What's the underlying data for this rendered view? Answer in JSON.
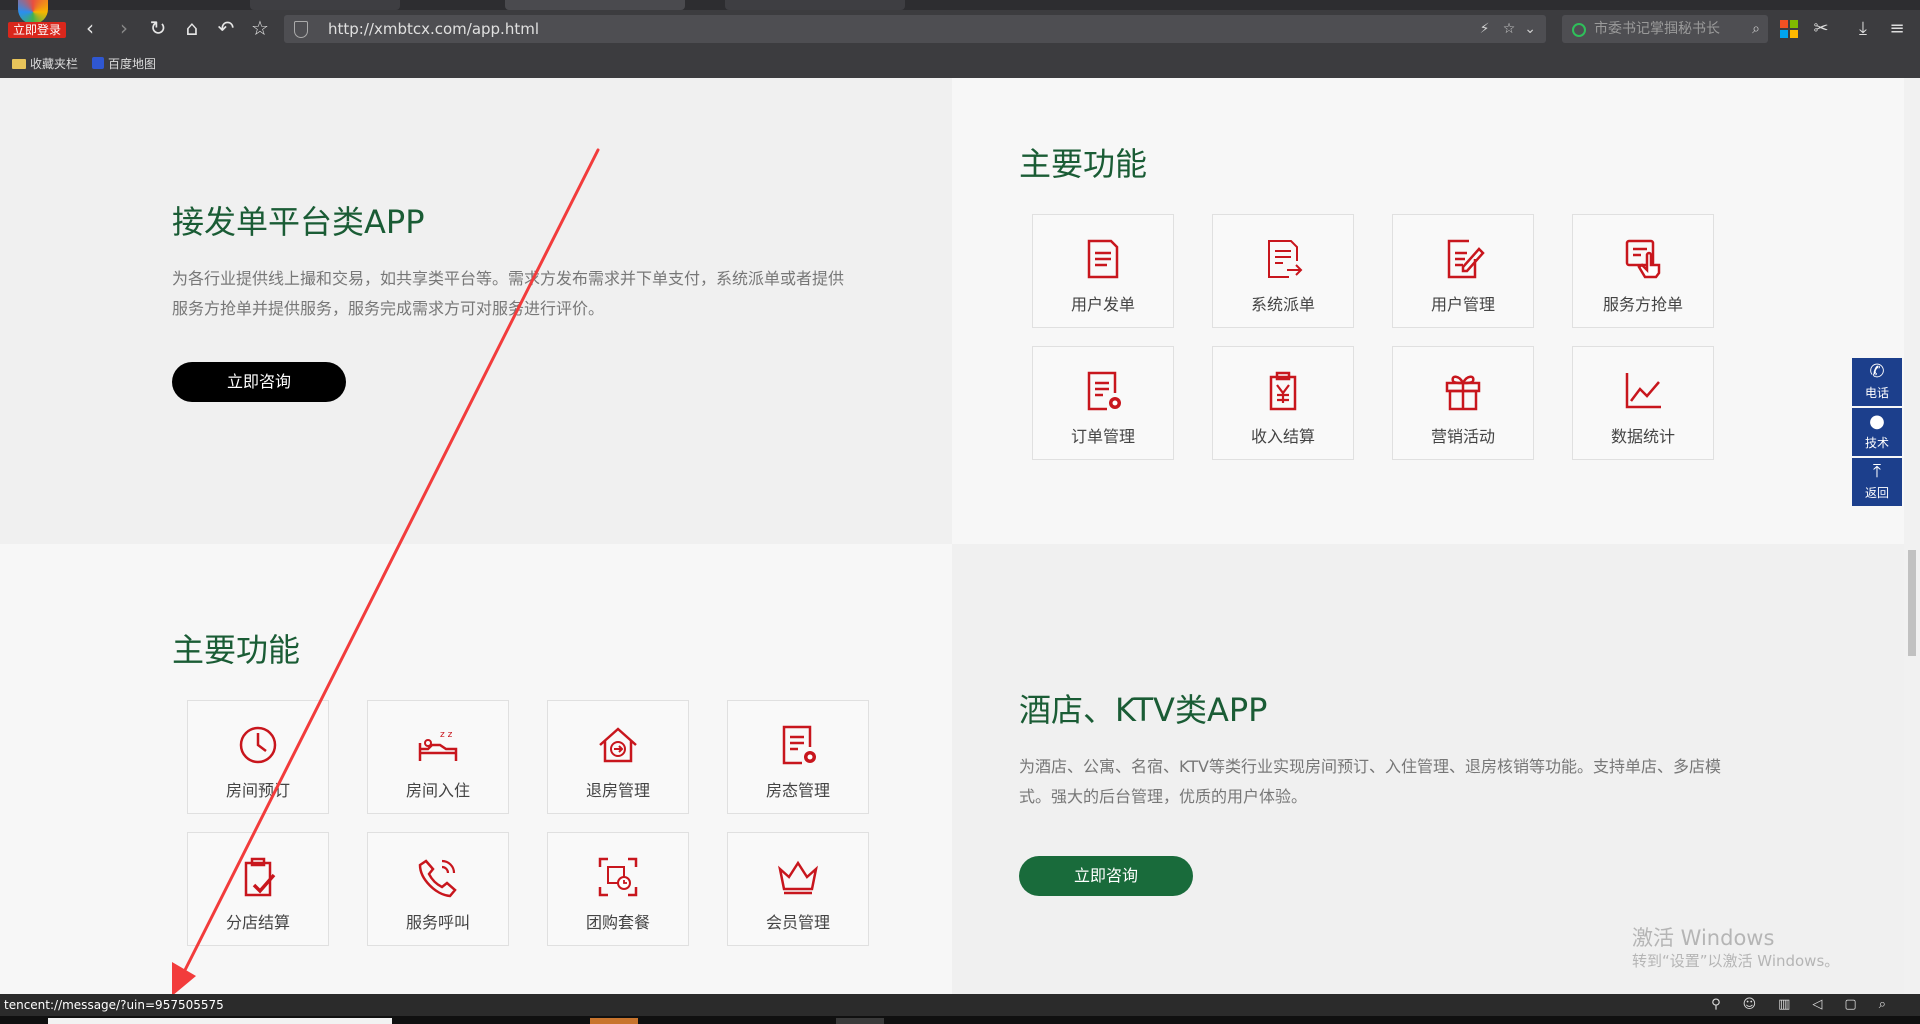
{
  "browser": {
    "logo_label": "立即登录",
    "url": "http://xmbtcx.com/app.html",
    "search_placeholder": "市委书记掌掴秘书长",
    "bookmarks": [
      "收藏夹栏",
      "百度地图"
    ],
    "status_url": "tencent://message/?uin=957505575"
  },
  "section1": {
    "title": "接发单平台类APP",
    "description": "为各行业提供线上撮和交易，如共享类平台等。需求方发布需求并下单支付，系统派单或者提供服务方抢单并提供服务，服务完成需求方可对服务进行评价。",
    "button": "立即咨询"
  },
  "section1_features": {
    "title": "主要功能",
    "items": [
      {
        "label": "用户发单",
        "icon": "document-list-icon"
      },
      {
        "label": "系统派单",
        "icon": "document-send-icon"
      },
      {
        "label": "用户管理",
        "icon": "document-edit-icon"
      },
      {
        "label": "服务方抢单",
        "icon": "hand-tap-icon"
      },
      {
        "label": "订单管理",
        "icon": "document-gear-icon"
      },
      {
        "label": "收入结算",
        "icon": "yen-clipboard-icon"
      },
      {
        "label": "营销活动",
        "icon": "gift-icon"
      },
      {
        "label": "数据统计",
        "icon": "line-chart-icon"
      }
    ]
  },
  "section2_features": {
    "title": "主要功能",
    "items": [
      {
        "label": "房间预订",
        "icon": "clock-icon"
      },
      {
        "label": "房间入住",
        "icon": "bed-icon"
      },
      {
        "label": "退房管理",
        "icon": "house-arrow-icon"
      },
      {
        "label": "房态管理",
        "icon": "document-gear-icon"
      },
      {
        "label": "分店结算",
        "icon": "clipboard-check-icon"
      },
      {
        "label": "服务呼叫",
        "icon": "phone-icon"
      },
      {
        "label": "团购套餐",
        "icon": "scan-clock-icon"
      },
      {
        "label": "会员管理",
        "icon": "crown-icon"
      }
    ]
  },
  "section2": {
    "title": "酒店、KTV类APP",
    "description": "为酒店、公寓、名宿、KTV等类行业实现房间预订、入住管理、退房核销等功能。支持单店、多店模式。强大的后台管理，优质的用户体验。",
    "button": "立即咨询"
  },
  "float_widget": {
    "phone": "电话",
    "tech": "技术",
    "back": "返回"
  },
  "watermark": {
    "line1": "激活 Windows",
    "line2": "转到“设置”以激活 Windows。"
  },
  "colors": {
    "accent_green": "#1a5c35",
    "icon_red": "#c8161d",
    "widget_blue": "#1c3f8c",
    "annotation_arrow": "#f23c3c"
  }
}
